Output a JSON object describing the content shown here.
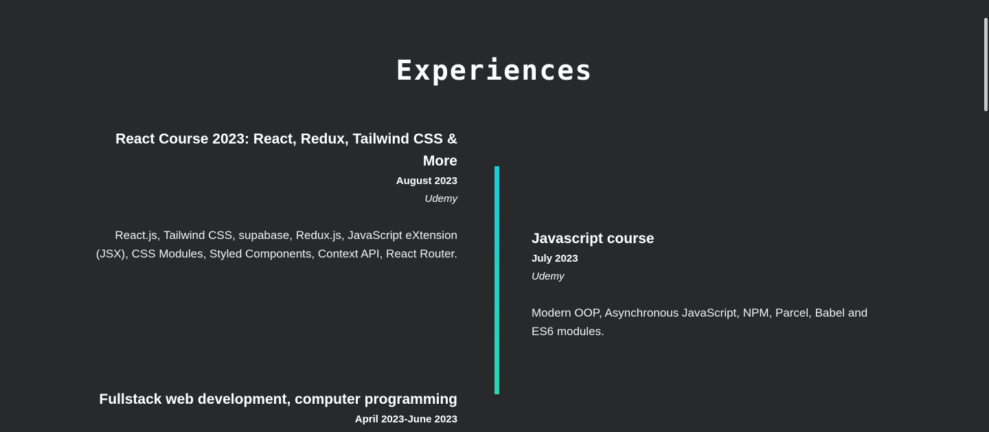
{
  "section": {
    "title": "Experiences"
  },
  "timeline": {
    "accent_top": "#1fc9d6",
    "accent_bottom": "#2fd3b2"
  },
  "experiences": [
    {
      "title": "React Course 2023: React, Redux, Tailwind CSS & More",
      "date": "August 2023",
      "provider": "Udemy",
      "description": "React.js, Tailwind CSS, supabase, Redux.js, JavaScript eXtension (JSX), CSS Modules, Styled Components, Context API, React Router."
    },
    {
      "title": "Javascript course",
      "date": "July 2023",
      "provider": "Udemy",
      "description": "Modern OOP, Asynchronous JavaScript, NPM, Parcel, Babel and ES6 modules."
    },
    {
      "title": "Fullstack web development, computer programming",
      "date": "April 2023-June 2023",
      "provider": "",
      "description": ""
    }
  ]
}
